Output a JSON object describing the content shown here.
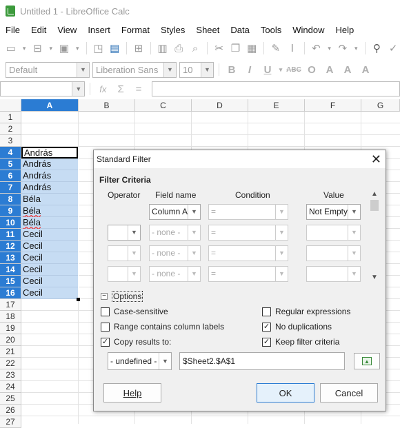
{
  "window": {
    "title": "Untitled 1 - LibreOffice Calc"
  },
  "menu": [
    "File",
    "Edit",
    "View",
    "Insert",
    "Format",
    "Styles",
    "Sheet",
    "Data",
    "Tools",
    "Window",
    "Help"
  ],
  "format_bar": {
    "style": "Default",
    "font": "Liberation Sans",
    "size": "10"
  },
  "columns": [
    "A",
    "B",
    "C",
    "D",
    "E",
    "F",
    "G"
  ],
  "rows": [
    "1",
    "2",
    "3",
    "4",
    "5",
    "6",
    "7",
    "8",
    "9",
    "10",
    "11",
    "12",
    "13",
    "14",
    "15",
    "16",
    "17",
    "18",
    "19",
    "20",
    "21",
    "22",
    "23",
    "24",
    "25",
    "26",
    "27"
  ],
  "column_a": {
    "r4": "András",
    "r5": "András",
    "r6": "András",
    "r7": "András",
    "r8": "Béla",
    "r9": "Béla",
    "r10": "Béla",
    "r11": "Cecil",
    "r12": "Cecil",
    "r13": "Cecil",
    "r14": "Cecil",
    "r15": "Cecil",
    "r16": "Cecil"
  },
  "dialog": {
    "title": "Standard Filter",
    "section": "Filter Criteria",
    "headers": {
      "operator": "Operator",
      "field": "Field name",
      "condition": "Condition",
      "value": "Value"
    },
    "rows": [
      {
        "operator": "",
        "field": "Column A",
        "condition": "=",
        "value": "Not Empty"
      },
      {
        "operator": "",
        "field": "- none -",
        "condition": "=",
        "value": ""
      },
      {
        "operator": "",
        "field": "- none -",
        "condition": "=",
        "value": ""
      },
      {
        "operator": "",
        "field": "- none -",
        "condition": "=",
        "value": ""
      }
    ],
    "options_label": "Options",
    "options": {
      "case_sensitive": "Case-sensitive",
      "range_headers": "Range contains column labels",
      "copy_results": "Copy results to:",
      "regex": "Regular expressions",
      "no_dup": "No duplications",
      "keep": "Keep filter criteria"
    },
    "copy_target_select": "- undefined -",
    "copy_target": "$Sheet2.$A$1",
    "buttons": {
      "help": "Help",
      "ok": "OK",
      "cancel": "Cancel"
    }
  }
}
